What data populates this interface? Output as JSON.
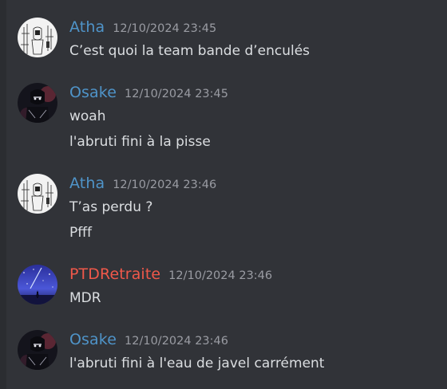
{
  "messages": [
    {
      "username": "Atha",
      "timestamp": "12/10/2024 23:45",
      "lines": [
        "C’est quoi la team bande d’enculés"
      ],
      "avatar": "sketch-avatar",
      "name_color": "#4f94c9"
    },
    {
      "username": "Osake",
      "timestamp": "12/10/2024 23:45",
      "lines": [
        "woah",
        "l'abruti fini à la pisse"
      ],
      "avatar": "dark-character-avatar",
      "name_color": "#4f94c9"
    },
    {
      "username": "Atha",
      "timestamp": "12/10/2024 23:46",
      "lines": [
        "T’as perdu ?",
        "Pfff"
      ],
      "avatar": "sketch-avatar",
      "name_color": "#4f94c9"
    },
    {
      "username": "PTDRetraite",
      "timestamp": "12/10/2024 23:46",
      "lines": [
        "MDR"
      ],
      "avatar": "night-sky-avatar",
      "name_color": "#f0584a"
    },
    {
      "username": "Osake",
      "timestamp": "12/10/2024 23:46",
      "lines": [
        "l'abruti fini à l'eau de javel carrément"
      ],
      "avatar": "dark-character-avatar",
      "name_color": "#4f94c9"
    }
  ]
}
